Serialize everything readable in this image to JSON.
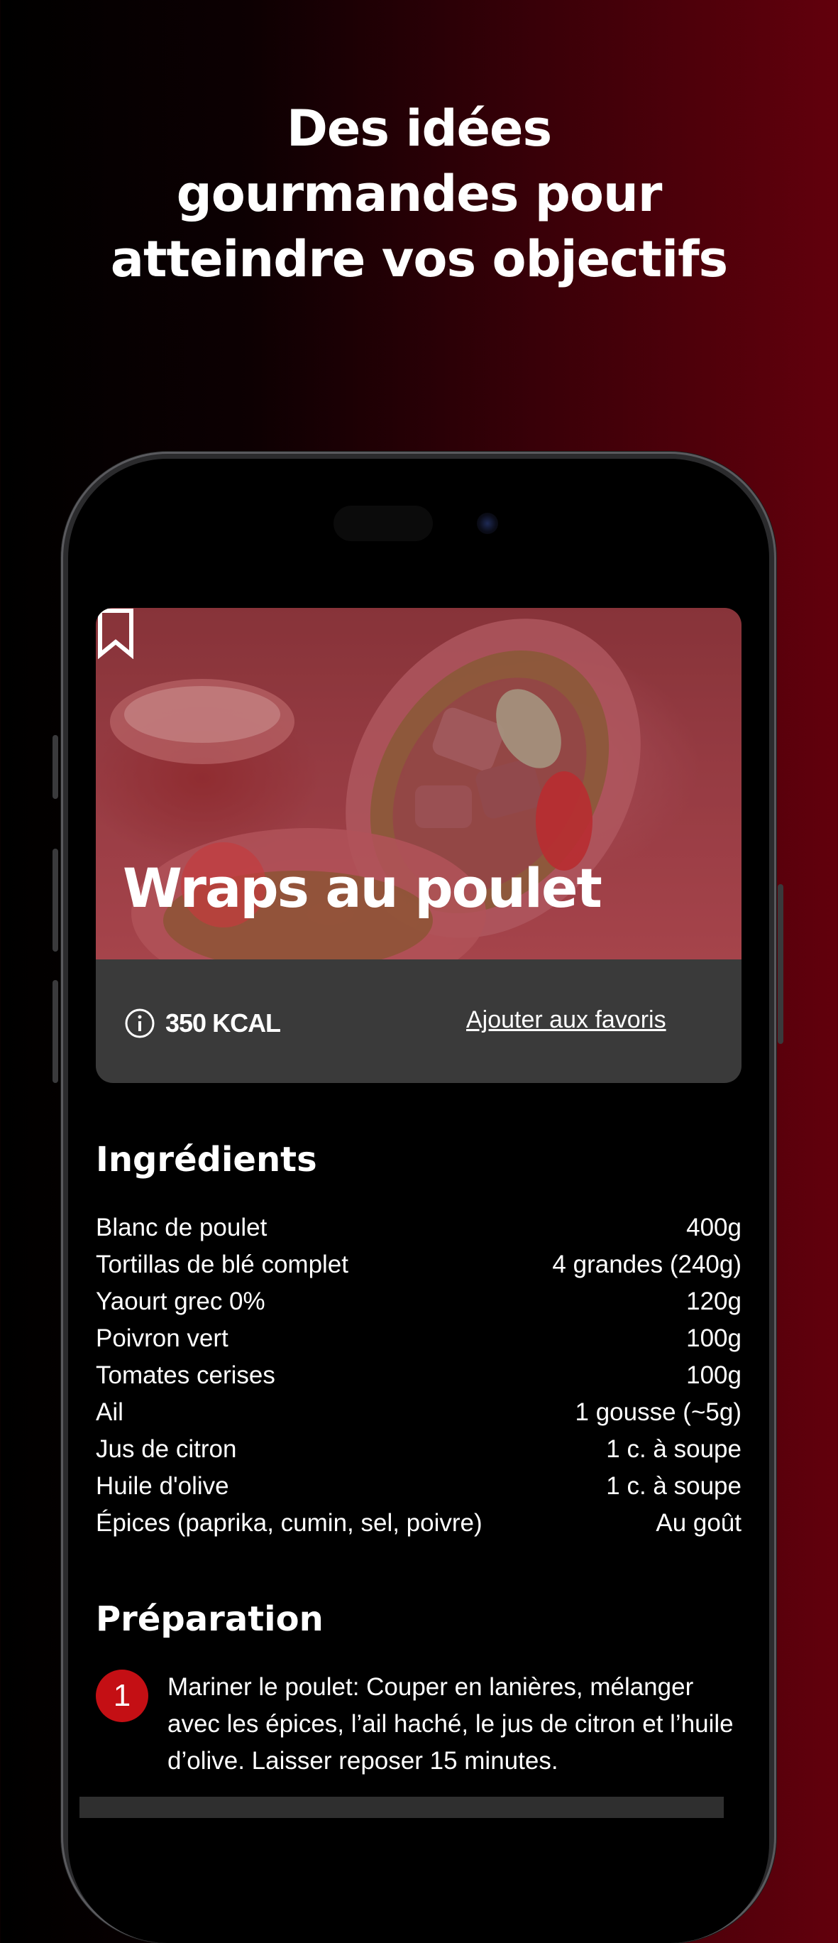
{
  "headline": [
    "Des idées",
    "gourmandes pour",
    "atteindre vos objectifs"
  ],
  "recipe": {
    "title": "Wraps au poulet",
    "calories": "350 KCAL",
    "favorite_link": "Ajouter aux favoris"
  },
  "ingredients": {
    "title": "Ingrédients",
    "items": [
      {
        "name": "Blanc de poulet",
        "qty": "400g"
      },
      {
        "name": "Tortillas de blé complet",
        "qty": "4 grandes (240g)"
      },
      {
        "name": "Yaourt grec 0%",
        "qty": "120g"
      },
      {
        "name": "Poivron vert",
        "qty": "100g"
      },
      {
        "name": "Tomates cerises",
        "qty": "100g"
      },
      {
        "name": "Ail",
        "qty": "1 gousse (~5g)"
      },
      {
        "name": "Jus de citron",
        "qty": "1 c. à soupe"
      },
      {
        "name": "Huile d'olive",
        "qty": "1 c. à soupe"
      },
      {
        "name": "Épices (paprika, cumin, sel, poivre)",
        "qty": "Au goût"
      }
    ]
  },
  "preparation": {
    "title": "Préparation",
    "steps": [
      {
        "number": "1",
        "text": "Mariner le poulet: Couper en lanières, mélanger avec les épices, l’ail haché, le jus de citron et l’huile d’olive. Laisser reposer 15 minutes."
      }
    ]
  },
  "icons": {
    "bookmark": "bookmark-icon",
    "info": "info-icon"
  },
  "colors": {
    "accent": "#c40f14",
    "card": "#3a3a3a",
    "background_end": "#62000c"
  }
}
